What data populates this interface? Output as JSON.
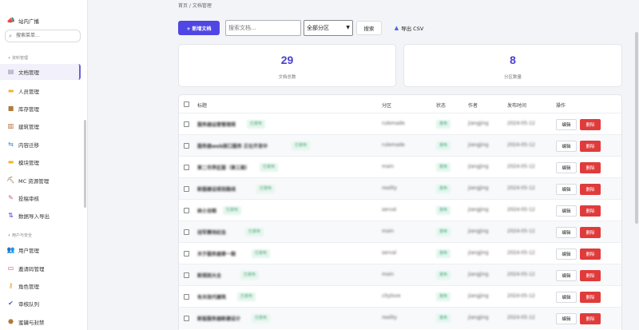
{
  "sidebar": {
    "top_item": {
      "label": "站内广播",
      "icon": "megaphone-icon"
    },
    "search_placeholder": "搜索菜单...",
    "section1": "资料管理",
    "items1": [
      {
        "label": "文档管理",
        "icon": "document-icon",
        "active": true
      },
      {
        "label": "人员管理",
        "icon": "folder-icon"
      },
      {
        "label": "库存管理",
        "icon": "box-icon"
      },
      {
        "label": "建筑管理",
        "icon": "building-icon"
      },
      {
        "label": "内容迁移",
        "icon": "transfer-icon"
      },
      {
        "label": "模块管理",
        "icon": "folder-icon"
      },
      {
        "label": "MC 资源管理",
        "icon": "pickaxe-icon"
      },
      {
        "label": "投稿审核",
        "icon": "review-icon"
      },
      {
        "label": "数据导入导出",
        "icon": "import-export-icon"
      }
    ],
    "section2": "用户与安全",
    "items2": [
      {
        "label": "用户管理",
        "icon": "users-icon"
      },
      {
        "label": "邀请码管理",
        "icon": "ticket-icon"
      },
      {
        "label": "角色管理",
        "icon": "key-icon"
      },
      {
        "label": "审核队列",
        "icon": "check-icon"
      },
      {
        "label": "蜜罐与封禁",
        "icon": "honeypot-icon"
      }
    ]
  },
  "breadcrumb": "首页 / 文档管理",
  "toolbar": {
    "new_label": "+ 新增文档",
    "search_placeholder": "搜索文档...",
    "select_value": "全部分区",
    "search_label": "搜索",
    "export_label": "导出 CSV"
  },
  "stats": [
    {
      "value": "29",
      "label": "文档总数"
    },
    {
      "value": "8",
      "label": "分区数量"
    }
  ],
  "table": {
    "headers": [
      "标题",
      "分区",
      "状态",
      "作者",
      "发布时间",
      "操作"
    ],
    "rows": [
      {
        "title": "服务器运营管理规",
        "tag": "已发布",
        "section": "rulemade",
        "status": "发布",
        "author": "jiangjing",
        "time": "2024-05-12"
      },
      {
        "title": "服务器web接口服务 正在开发中",
        "tag": "已发布",
        "section": "rulemade",
        "status": "发布",
        "author": "jiangjing",
        "time": "2024-05-12"
      },
      {
        "title": "第二世界区服（第三期）",
        "tag": "已发布",
        "section": "main",
        "status": "发布",
        "author": "jiangjing",
        "time": "2024-05-12"
      },
      {
        "title": "新服建设规划路线",
        "tag": "已发布",
        "section": "reality",
        "status": "发布",
        "author": "jiangjing",
        "time": "2024-05-12"
      },
      {
        "title": "纳士谷图",
        "tag": "已发布",
        "section": "serval",
        "status": "发布",
        "author": "jiangjing",
        "time": "2024-05-12"
      },
      {
        "title": "冠军赛场纪念",
        "tag": "已发布",
        "section": "main",
        "status": "发布",
        "author": "jiangjing",
        "time": "2024-05-12"
      },
      {
        "title": "关于服务器第一期",
        "tag": "已发布",
        "section": "serval",
        "status": "发布",
        "author": "jiangjing",
        "time": "2024-05-12"
      },
      {
        "title": "新规则大全",
        "tag": "已发布",
        "section": "main",
        "status": "发布",
        "author": "jiangjing",
        "time": "2024-05-12"
      },
      {
        "title": "有关现代建筑",
        "tag": "已发布",
        "section": "citylove",
        "status": "发布",
        "author": "jiangjing",
        "time": "2024-05-12"
      },
      {
        "title": "新版服务器新建设计",
        "tag": "已发布",
        "section": "reality",
        "status": "发布",
        "author": "jiangjing",
        "time": "2024-05-12"
      }
    ],
    "edit_label": "编辑",
    "delete_label": "删除"
  }
}
